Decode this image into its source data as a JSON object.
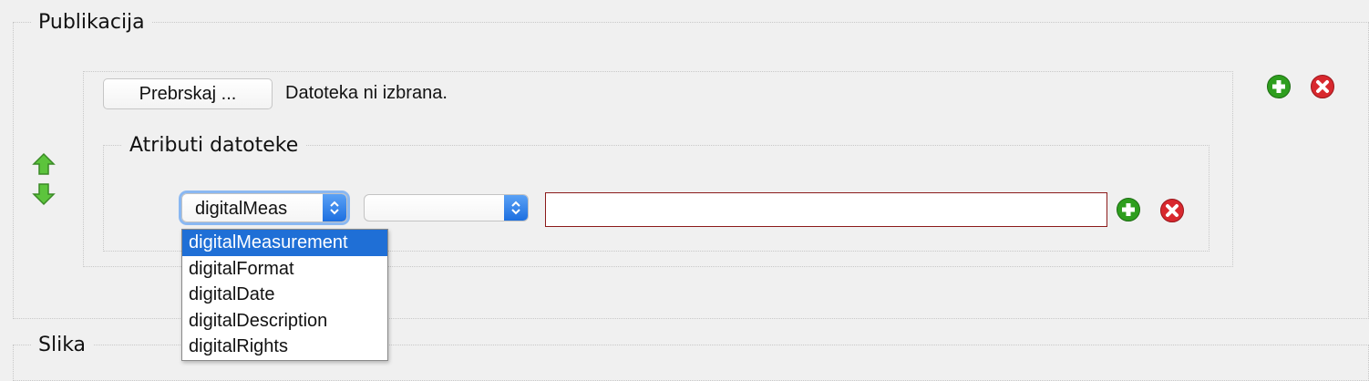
{
  "sections": {
    "publikacija_title": "Publikacija",
    "slika_title": "Slika"
  },
  "file": {
    "browse_label": "Prebrskaj ...",
    "status": "Datoteka ni izbrana."
  },
  "attributes": {
    "title": "Atributi datoteke",
    "attribute_select_value": "digitalMeas",
    "qualifier_select_value": "",
    "value_input": ""
  },
  "dropdown": {
    "options": [
      {
        "label": "digitalMeasurement",
        "selected": true
      },
      {
        "label": "digitalFormat",
        "selected": false
      },
      {
        "label": "digitalDate",
        "selected": false
      },
      {
        "label": "digitalDescription",
        "selected": false
      },
      {
        "label": "digitalRights",
        "selected": false
      }
    ]
  },
  "icons": {
    "add": "add-icon",
    "remove": "remove-icon",
    "move_up": "arrow-up-icon",
    "move_down": "arrow-down-icon"
  },
  "colors": {
    "add_green": "#2e9e1e",
    "remove_red": "#d8282e",
    "select_blue": "#1f6fd6",
    "input_border": "#8b1a1a",
    "arrow_green": "#5cc43c"
  }
}
